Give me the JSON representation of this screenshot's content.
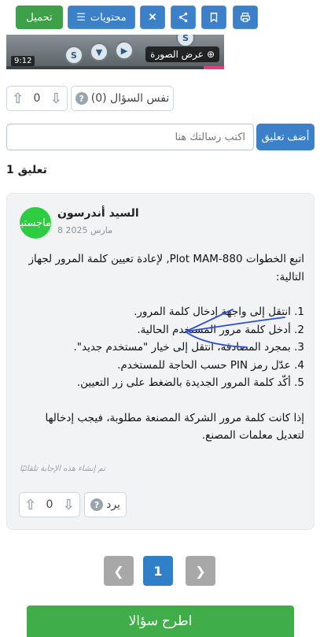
{
  "toolbar": {
    "download_label": "تحميل",
    "contents_label": "محتويات",
    "close_icon": "close-icon",
    "share_icon": "share-icon",
    "bookmark_icon": "bookmark-icon",
    "print_icon": "print-icon"
  },
  "video": {
    "duration": "9:12",
    "view_image_label": "عرض الصورة",
    "knob_labels": [
      "S",
      "▼",
      "▶",
      "S"
    ]
  },
  "question_votes": {
    "count": "0",
    "same_question_label": "نفس السؤال (0)"
  },
  "comment": {
    "placeholder": "اكتب رسالتك هنا",
    "add_label": "أضف تعليق"
  },
  "comments_count_label": "تعليق 1",
  "answer": {
    "avatar_text": "ماجستير",
    "author": "السيد أندرسون",
    "date": "8 مارس 2025",
    "intro": "اتبع الخطوات Plot MAM-880, لإعادة تعيين كلمة المرور لجهاز التالية:",
    "steps": [
      "1. انتقل إلى واجهة إدخال كلمة المرور.",
      "2. أدخل كلمة مرور المستخدم الحالية.",
      "3. بمجرد المصادقة، انتقل إلى خيار \"مستخدم جديد\".",
      "4. عدّل رمز PIN حسب الحاجة للمستخدم.",
      "5. أكّد كلمة المرور الجديدة بالضغط على زر التعيين."
    ],
    "note": "إذا كانت كلمة مرور الشركة المصنعة مطلوبة، فيجب إدخالها لتعديل معلمات المصنع.",
    "auto_note": "تم إنشاء هذه الإجابة تلقائيًا",
    "vote_count": "0",
    "reply_label": "يرد"
  },
  "pagination": {
    "current_page": "1",
    "prev_icon": "chevron-left-icon",
    "next_icon": "chevron-right-icon"
  },
  "ask_button_label": "اطرح سؤالا",
  "colors": {
    "primary": "#3b80c9",
    "green": "#3fa04a",
    "card_bg": "#f1f3f5",
    "annotation": "#2b4fd6"
  }
}
